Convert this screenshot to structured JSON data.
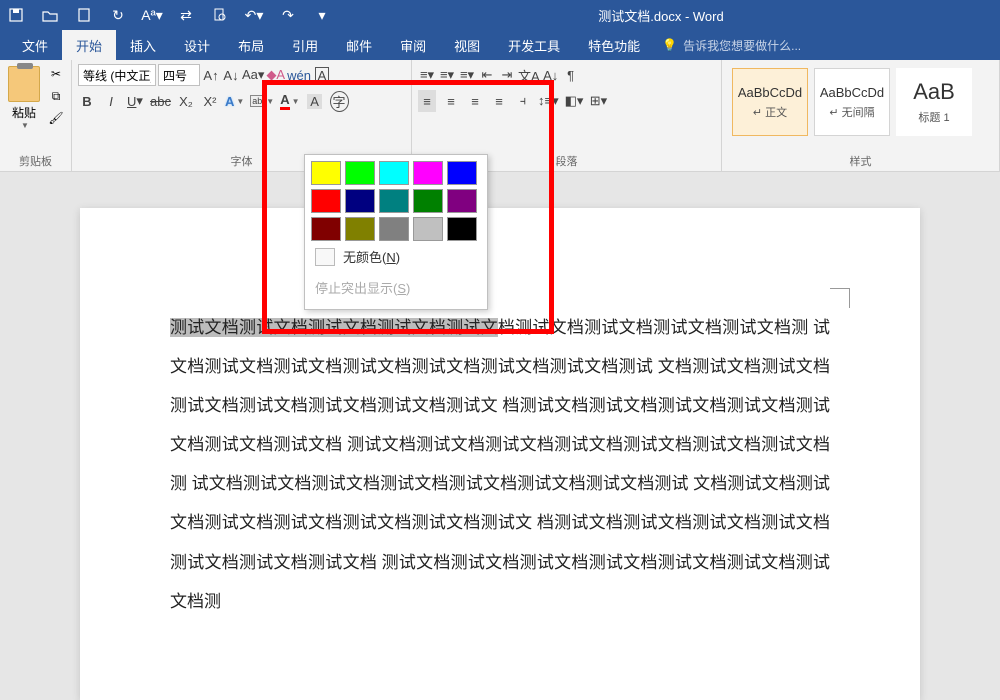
{
  "title": "测试文档.docx - Word",
  "tabs": {
    "file": "文件",
    "home": "开始",
    "insert": "插入",
    "design": "设计",
    "layout": "布局",
    "references": "引用",
    "mail": "邮件",
    "review": "审阅",
    "view": "视图",
    "devtools": "开发工具",
    "special": "特色功能"
  },
  "tell_me": "告诉我您想要做什么...",
  "ribbon": {
    "clipboard": {
      "paste": "粘贴",
      "label": "剪贴板"
    },
    "font": {
      "name": "等线 (中文正)",
      "size": "四号",
      "label": "字体"
    },
    "paragraph": {
      "label": "段落"
    },
    "styles": {
      "label": "样式",
      "items": [
        {
          "big": "AaBbCcDd",
          "name": "↵ 正文"
        },
        {
          "big": "AaBbCcDd",
          "name": "↵ 无间隔"
        },
        {
          "big": "AaB",
          "name": "标题 1"
        }
      ]
    }
  },
  "highlight_menu": {
    "colors": [
      "#ffff00",
      "#00ff00",
      "#00ffff",
      "#ff00ff",
      "#0000ff",
      "#ff0000",
      "#000080",
      "#008080",
      "#008000",
      "#800080",
      "#800000",
      "#808000",
      "#808080",
      "#c0c0c0",
      "#000000"
    ],
    "no_color": "无颜色(N)",
    "stop": "停止突出显示(S)"
  },
  "doc": {
    "selected": "测试文档测试文档测试文档测试文档测试文",
    "rest1": "档测试文档测试文档测试文档测试文档测",
    "lines": [
      "试文档测试文档测试文档测试文档测试文档测试文档测试文档测试",
      "文档测试文档测试文档测试文档测试文档测试文档测试文档测试文",
      "档测试文档测试文档测试文档测试文档测试文档测试文档测试文档",
      "测试文档测试文档测试文档测试文档测试文档测试文档测试文档测",
      "试文档测试文档测试文档测试文档测试文档测试文档测试文档测试",
      "文档测试文档测试文档测试文档测试文档测试文档测试文档测试文",
      "档测试文档测试文档测试文档测试文档测试文档测试文档测试文档",
      "测试文档测试文档测试文档测试文档测试文档测试文档测试文档测"
    ]
  }
}
